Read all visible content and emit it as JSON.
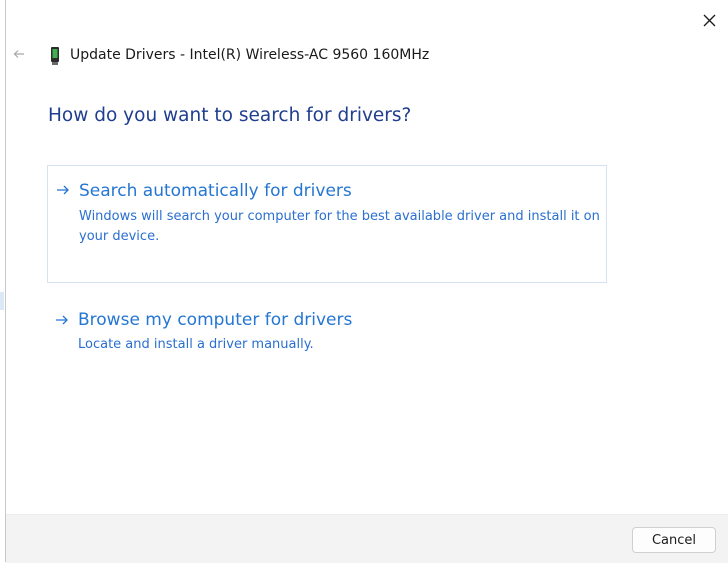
{
  "window": {
    "title": "Update Drivers - Intel(R) Wireless-AC 9560 160MHz"
  },
  "main": {
    "heading": "How do you want to search for drivers?",
    "options": [
      {
        "title": "Search automatically for drivers",
        "description": "Windows will search your computer for the best available driver and install it on your device."
      },
      {
        "title": "Browse my computer for drivers",
        "description": "Locate and install a driver manually."
      }
    ]
  },
  "footer": {
    "cancel_label": "Cancel"
  },
  "icons": {
    "close": "close-icon",
    "back": "back-arrow-icon",
    "device": "network-adapter-icon",
    "option_arrow": "arrow-right-icon"
  },
  "colors": {
    "heading": "#1f3e8f",
    "link": "#2576d2",
    "footer_bg": "#f3f3f3"
  }
}
